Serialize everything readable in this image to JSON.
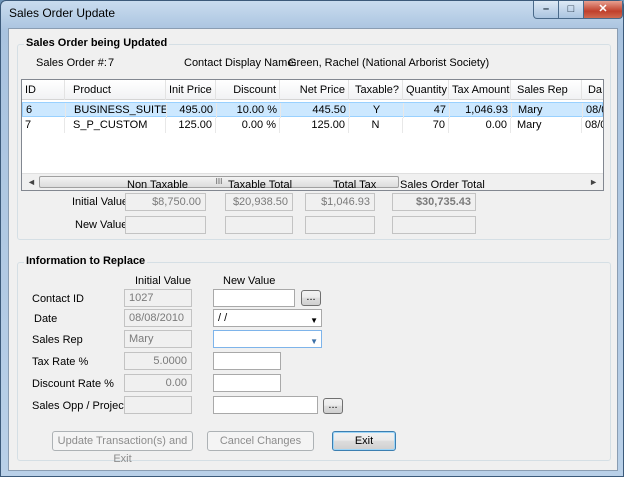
{
  "window": {
    "title": "Sales Order Update",
    "min": "–",
    "max": "□",
    "close": "✕"
  },
  "order_group": {
    "title": "Sales Order being Updated",
    "order_no_label": "Sales Order #:",
    "order_no": "7",
    "contact_label": "Contact Display Name:",
    "contact_name": "Green, Rachel (National Arborist Society)"
  },
  "grid": {
    "columns": [
      "ID",
      "Product",
      "Init Price",
      "Discount",
      "Net Price",
      "Taxable?",
      "Quantity",
      "Tax Amount",
      "Sales Rep",
      "Da"
    ],
    "rows": [
      {
        "id": "6",
        "product": "BUSINESS_SUITE",
        "init_price": "495.00",
        "discount": "10.00 %",
        "net_price": "445.50",
        "taxable": "Y",
        "quantity": "47",
        "tax_amount": "1,046.93",
        "sales_rep": "Mary",
        "date": "08/0"
      },
      {
        "id": "7",
        "product": "S_P_CUSTOM",
        "init_price": "125.00",
        "discount": "0.00 %",
        "net_price": "125.00",
        "taxable": "N",
        "quantity": "70",
        "tax_amount": "0.00",
        "sales_rep": "Mary",
        "date": "08/0"
      }
    ],
    "scroll_left": "◄",
    "scroll_right": "►",
    "thumb_grip": "III"
  },
  "totals": {
    "headers": [
      "Non Taxable",
      "Taxable Total",
      "Total Tax",
      "Sales Order Total"
    ],
    "initial_label": "Initial Value",
    "new_label": "New Value",
    "initial": [
      "$8,750.00",
      "$20,938.50",
      "$1,046.93",
      "$30,735.43"
    ],
    "new": [
      "",
      "",
      "",
      ""
    ]
  },
  "replace_group": {
    "title": "Information to Replace",
    "initial_header": "Initial Value",
    "new_header": "New Value",
    "fields": {
      "contact_id": {
        "label": "Contact ID",
        "initial": "1027",
        "new": ""
      },
      "date": {
        "label": "Date",
        "initial": "08/08/2010",
        "new": " / /"
      },
      "sales_rep": {
        "label": "Sales Rep",
        "initial": "Mary",
        "new": ""
      },
      "tax_rate": {
        "label": "Tax Rate %",
        "initial": "5.0000",
        "new": ""
      },
      "discount_rate": {
        "label": "Discount Rate %",
        "initial": "0.00",
        "new": ""
      },
      "sales_opp": {
        "label": "Sales Opp / Project",
        "initial": "",
        "new": ""
      }
    },
    "browse": "..."
  },
  "buttons": {
    "update": "Update Transaction(s) and Exit",
    "cancel": "Cancel Changes",
    "exit": "Exit"
  }
}
